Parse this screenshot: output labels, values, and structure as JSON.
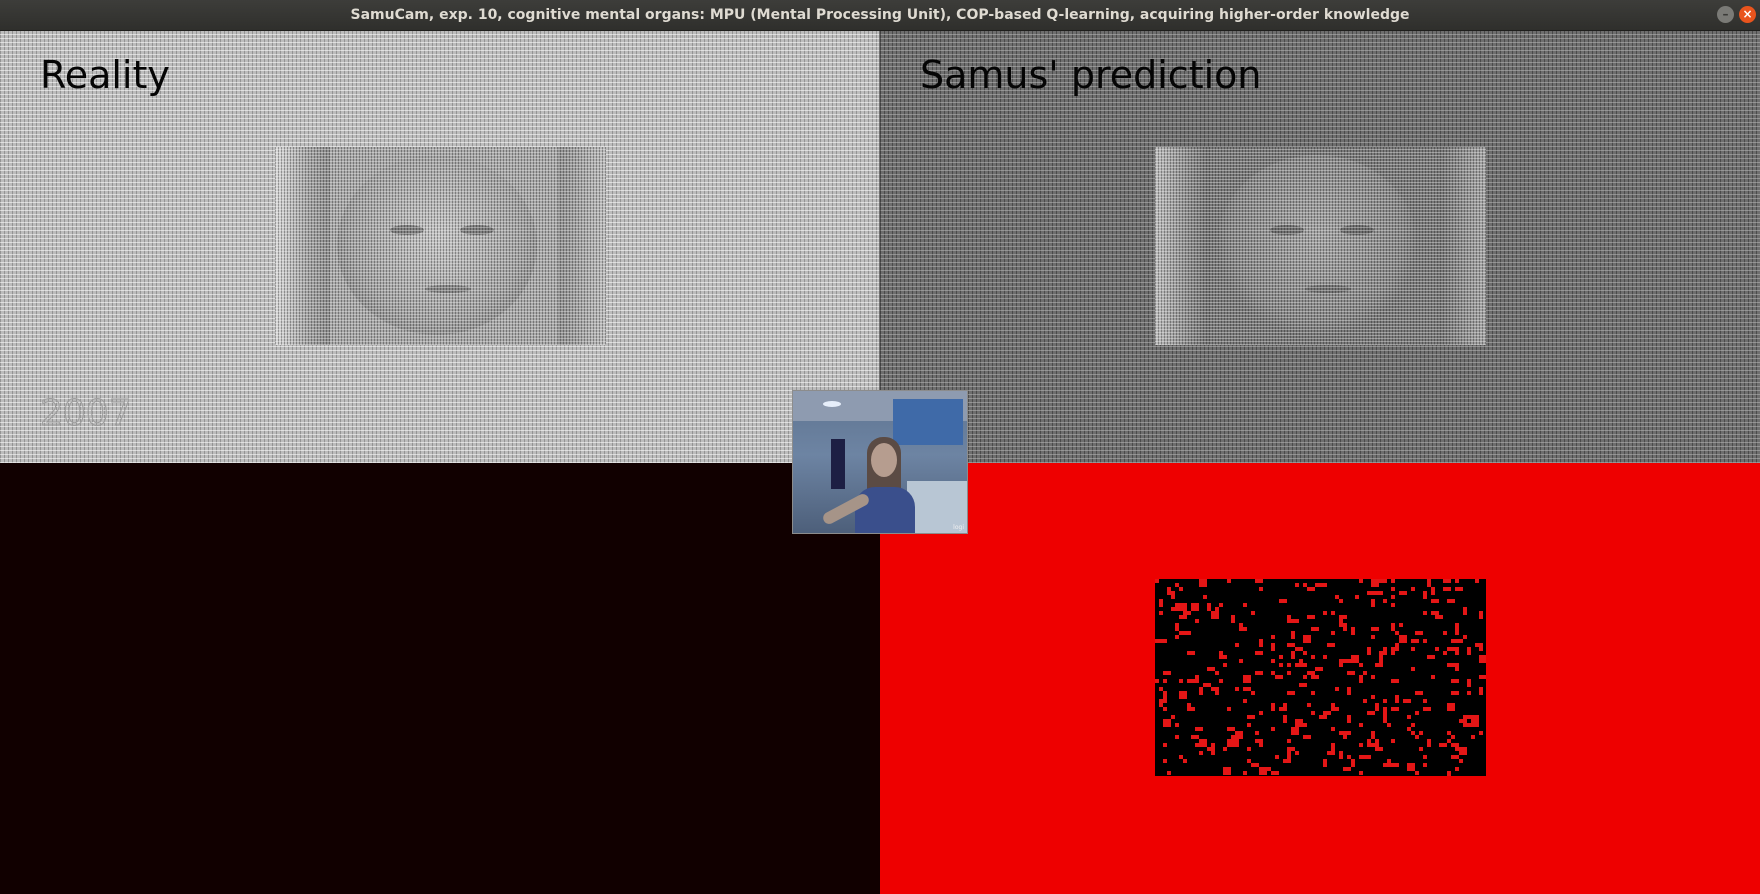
{
  "window": {
    "title": "SamuCam, exp. 10, cognitive mental organs: MPU (Mental Processing Unit), COP-based Q-learning, acquiring higher-order knowledge",
    "controls": {
      "minimize": "–",
      "close": "×"
    }
  },
  "panels": {
    "reality": {
      "label": "Reality",
      "year": "2007"
    },
    "prediction": {
      "label": "Samus' prediction"
    }
  },
  "webcam": {
    "logo": "logi"
  },
  "colors": {
    "error_background": "#ee0000",
    "error_pixel": "#e41616",
    "dark_panel": "#110000"
  },
  "icons": {
    "minimize": "minimize-icon",
    "close": "close-icon"
  }
}
